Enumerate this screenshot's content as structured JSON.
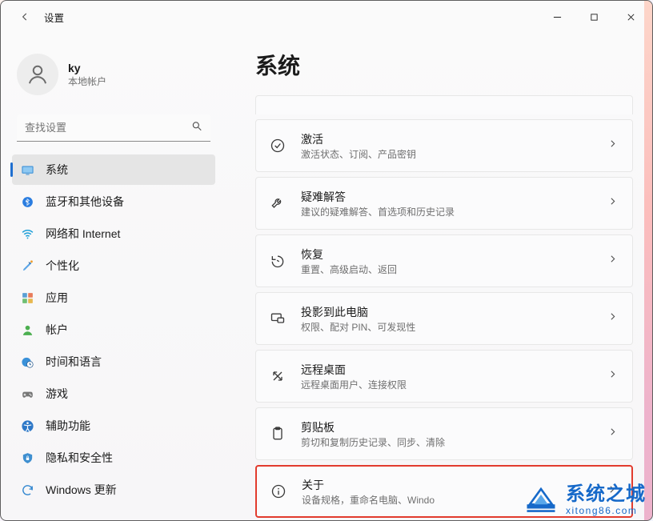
{
  "titlebar": {
    "app_title": "设置"
  },
  "profile": {
    "name": "ky",
    "subtitle": "本地帐户"
  },
  "search": {
    "placeholder": "查找设置"
  },
  "sidebar": {
    "items": [
      {
        "id": "system",
        "label": "系统"
      },
      {
        "id": "bluetooth",
        "label": "蓝牙和其他设备"
      },
      {
        "id": "network",
        "label": "网络和 Internet"
      },
      {
        "id": "personalize",
        "label": "个性化"
      },
      {
        "id": "apps",
        "label": "应用"
      },
      {
        "id": "accounts",
        "label": "帐户"
      },
      {
        "id": "time",
        "label": "时间和语言"
      },
      {
        "id": "gaming",
        "label": "游戏"
      },
      {
        "id": "accessibility",
        "label": "辅助功能"
      },
      {
        "id": "privacy",
        "label": "隐私和安全性"
      },
      {
        "id": "update",
        "label": "Windows 更新"
      }
    ]
  },
  "page": {
    "title": "系统"
  },
  "tiles": {
    "peek_sub": "",
    "items": [
      {
        "id": "activation",
        "title": "激活",
        "subtitle": "激活状态、订阅、产品密钥"
      },
      {
        "id": "troubleshoot",
        "title": "疑难解答",
        "subtitle": "建议的疑难解答、首选项和历史记录"
      },
      {
        "id": "recovery",
        "title": "恢复",
        "subtitle": "重置、高级启动、返回"
      },
      {
        "id": "projecting",
        "title": "投影到此电脑",
        "subtitle": "权限、配对 PIN、可发现性"
      },
      {
        "id": "remote",
        "title": "远程桌面",
        "subtitle": "远程桌面用户、连接权限"
      },
      {
        "id": "clipboard",
        "title": "剪贴板",
        "subtitle": "剪切和复制历史记录、同步、清除"
      },
      {
        "id": "about",
        "title": "关于",
        "subtitle": "设备规格，重命名电脑、Windo"
      }
    ]
  },
  "watermark": {
    "main": "系统之城",
    "sub": "xitong86.com"
  }
}
